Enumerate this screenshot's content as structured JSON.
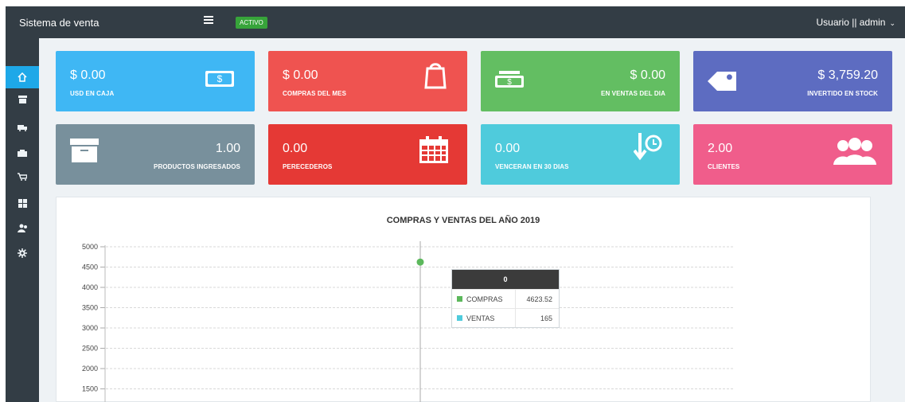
{
  "app": {
    "brand": "Sistema de venta",
    "status": "ACTIVO",
    "user": "Usuario || admin"
  },
  "sidebar": [
    {
      "name": "home-icon",
      "active": true
    },
    {
      "name": "archive-icon"
    },
    {
      "name": "truck-icon"
    },
    {
      "name": "cash-register-icon"
    },
    {
      "name": "cart-icon"
    },
    {
      "name": "grid-icon"
    },
    {
      "name": "users-icon"
    },
    {
      "name": "gear-icon"
    }
  ],
  "cards": [
    {
      "value": "$ 0.00",
      "label": "USD EN CAJA",
      "color": "#3fb7f4",
      "icon": "cash-icon"
    },
    {
      "value": "$ 0.00",
      "label": "COMPRAS DEL MES",
      "color": "#ef5350",
      "icon": "shopping-bag-icon"
    },
    {
      "value": "$ 0.00",
      "label": "EN VENTAS DEL DIA",
      "color": "#63be62",
      "icon": "cash-register-icon"
    },
    {
      "value": "$ 3,759.20",
      "label": "INVERTIDO EN STOCK",
      "color": "#5d6cc1",
      "icon": "tag-icon"
    },
    {
      "value": "1.00",
      "label": "PRODUCTOS INGRESADOS",
      "color": "#78909c",
      "icon": "archive-icon"
    },
    {
      "value": "0.00",
      "label": "PERECEDEROS",
      "color": "#e53935",
      "icon": "calendar-icon"
    },
    {
      "value": "0.00",
      "label": "VENCERAN EN 30 DIAS",
      "color": "#4fcbdc",
      "icon": "clock-down-icon"
    },
    {
      "value": "2.00",
      "label": "CLIENTES",
      "color": "#f05d8b",
      "icon": "users-icon"
    }
  ],
  "chart_data": {
    "type": "line",
    "title": "COMPRAS Y VENTAS DEL AÑO 2019",
    "y_ticks": [
      5000,
      4500,
      4000,
      3500,
      3000,
      2500,
      2000,
      1500
    ],
    "x": [
      0
    ],
    "series": [
      {
        "name": "COMPRAS",
        "color": "#5cb85c",
        "values": [
          4623.52
        ]
      },
      {
        "name": "VENTAS",
        "color": "#4fcbdc",
        "values": [
          165
        ]
      }
    ],
    "tooltip": {
      "title": "0",
      "rows": [
        {
          "name": "COMPRAS",
          "value": "4623.52"
        },
        {
          "name": "VENTAS",
          "value": "165"
        }
      ]
    }
  }
}
